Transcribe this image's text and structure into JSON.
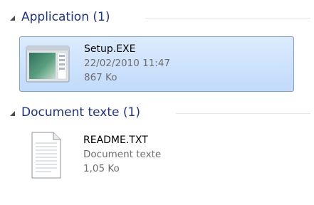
{
  "groups": [
    {
      "title": "Application (1)",
      "items": [
        {
          "name": "Setup.EXE",
          "line2": "22/02/2010 11:47",
          "line3": "867 Ko",
          "icon": "application-window-icon",
          "selected": true
        }
      ]
    },
    {
      "title": "Document texte (1)",
      "items": [
        {
          "name": "README.TXT",
          "line2": "Document texte",
          "line3": "1,05 Ko",
          "icon": "text-document-icon",
          "selected": false
        }
      ]
    }
  ],
  "colors": {
    "group_title": "#1e3287",
    "selection_fill": "#c1dbfc",
    "selection_border": "#7da2ce",
    "meta_text": "#6d6d6d"
  }
}
